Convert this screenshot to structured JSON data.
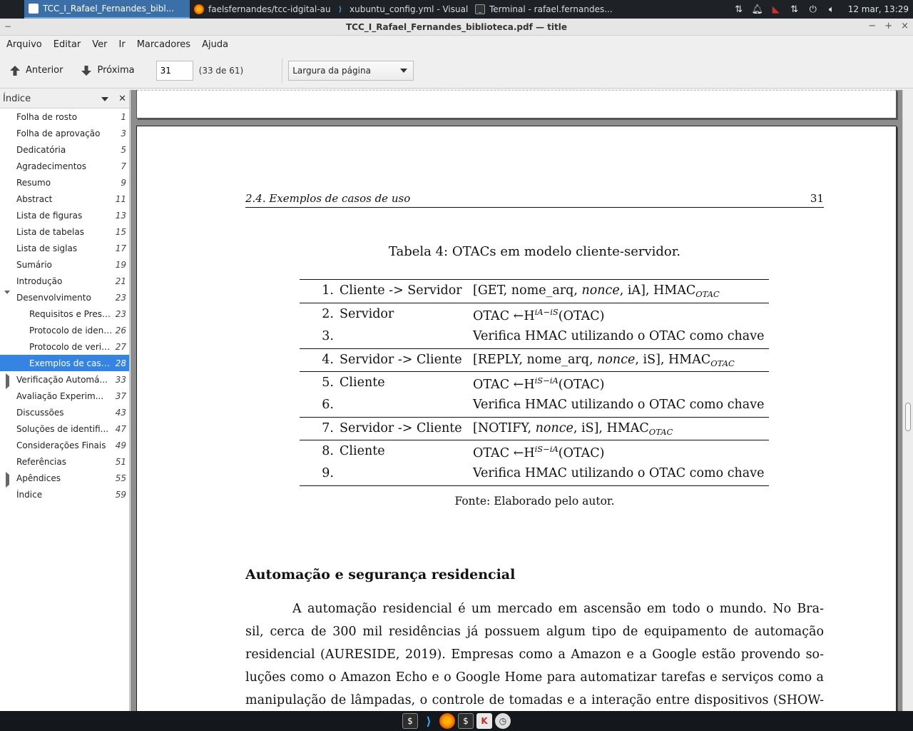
{
  "taskbar": {
    "tasks": [
      {
        "label": "TCC_I_Rafael_Fernandes_bibl...",
        "active": true
      },
      {
        "label": "faelsfernandes/tcc-idgital-au..."
      },
      {
        "label": "xubuntu_config.yml - Visual S..."
      },
      {
        "label": "Terminal - rafael.fernandes..."
      }
    ],
    "clock": "12 mar, 13:29",
    "tray_icons": [
      "network-icon",
      "notification-bell-icon",
      "antivirus-icon",
      "network-transfer-icon",
      "power-icon",
      "volume-icon"
    ]
  },
  "window": {
    "title": "TCC_I_Rafael_Fernandes_biblioteca.pdf — title",
    "menu_button": "−",
    "controls": [
      "−",
      "+",
      "×"
    ]
  },
  "menubar": [
    "Arquivo",
    "Editar",
    "Ver",
    "Ir",
    "Marcadores",
    "Ajuda"
  ],
  "toolbar": {
    "prev_label": "Anterior",
    "next_label": "Próxima",
    "page_value": "31",
    "page_count": "(33 de 61)",
    "zoom": "Largura da página"
  },
  "sidebar": {
    "title": "Índice",
    "items": [
      {
        "label": "Folha de rosto",
        "page": "1"
      },
      {
        "label": "Folha de aprovação",
        "page": "3"
      },
      {
        "label": "Dedicatória",
        "page": "5"
      },
      {
        "label": "Agradecimentos",
        "page": "7"
      },
      {
        "label": "Resumo",
        "page": "9"
      },
      {
        "label": "Abstract",
        "page": "11"
      },
      {
        "label": "Lista de figuras",
        "page": "13"
      },
      {
        "label": "Lista de tabelas",
        "page": "15"
      },
      {
        "label": "Lista de siglas",
        "page": "17"
      },
      {
        "label": "Sumário",
        "page": "19"
      },
      {
        "label": "Introdução",
        "page": "21"
      },
      {
        "label": "Desenvolvimento",
        "page": "23",
        "expanded": true
      },
      {
        "label": "Requisitos e Pressu...",
        "page": "23",
        "level": 2
      },
      {
        "label": "Protocolo de identif...",
        "page": "26",
        "level": 2
      },
      {
        "label": "Protocolo de verific...",
        "page": "27",
        "level": 2
      },
      {
        "label": "Exemplos de casos ...",
        "page": "28",
        "level": 2,
        "selected": true
      },
      {
        "label": "Verificação Automá...",
        "page": "33",
        "collapsed": true
      },
      {
        "label": "Avaliação Experim...",
        "page": "37"
      },
      {
        "label": "Discussões",
        "page": "43"
      },
      {
        "label": "Soluções de identifi...",
        "page": "47"
      },
      {
        "label": "Considerações Finais",
        "page": "49"
      },
      {
        "label": "Referências",
        "page": "51"
      },
      {
        "label": "Apêndices",
        "page": "55",
        "collapsed": true
      },
      {
        "label": "Índice",
        "page": "59"
      }
    ]
  },
  "document": {
    "running_head_section": "2.4.   Exemplos de casos de uso",
    "running_head_page": "31",
    "table_caption": "Tabela 4:  OTACs em modelo cliente-servidor.",
    "table_rows": [
      {
        "num": "1.",
        "actor": "Cliente -> Servidor",
        "a1": "[GET, nome_arq, ",
        "it": "nonce",
        "a2": ", iA], HMAC",
        "sub": "OTAC"
      },
      {
        "num": "2.",
        "actor": "Servidor",
        "a1": "OTAC ←H",
        "sup": "iA−iS",
        "a2": "(OTAC)"
      },
      {
        "num": "3.",
        "actor": "",
        "a1": "Verifica HMAC utilizando o OTAC como chave"
      },
      {
        "num": "4.",
        "actor": "Servidor -> Cliente",
        "a1": "[REPLY, nome_arq, ",
        "it": "nonce",
        "a2": ", iS], HMAC",
        "sub": "OTAC"
      },
      {
        "num": "5.",
        "actor": "Cliente",
        "a1": "OTAC ←H",
        "sup": "iS−iA",
        "a2": "(OTAC)"
      },
      {
        "num": "6.",
        "actor": "",
        "a1": "Verifica HMAC utilizando o OTAC como chave"
      },
      {
        "num": "7.",
        "actor": "Servidor -> Cliente",
        "a1": "[NOTIFY, ",
        "it": "nonce",
        "a2": ", iS], HMAC",
        "sub": "OTAC"
      },
      {
        "num": "8.",
        "actor": "Cliente",
        "a1": "OTAC ←H",
        "sup": "iS−iA",
        "a2": "(OTAC)"
      },
      {
        "num": "9.",
        "actor": "",
        "a1": "Verifica HMAC utilizando o OTAC como chave"
      }
    ],
    "source": "Fonte:  Elaborado pelo autor.",
    "section_title": "Automação e segurança residencial",
    "paragraph_lines": [
      "A automação residencial é um mercado em ascensão em todo o mundo.  No Bra-",
      "sil, cerca de 300 mil residências já possuem algum tipo de equipamento de automação",
      "residencial (AURESIDE, 2019).  Empresas como a Amazon e a Google estão provendo so-",
      "luções como o Amazon Echo e o Google Home para automatizar tarefas e serviços como a",
      "manipulação de lâmpadas, o controle de tomadas e a interação entre dispositivos (SHOW-"
    ]
  },
  "dock": [
    "terminal-icon",
    "vscode-icon",
    "firefox-icon",
    "terminal-icon",
    "kaspersky-icon",
    "clock-icon"
  ],
  "colors": {
    "selection": "#3584e4",
    "panel": "#1e2126",
    "active_task": "#3b6fa8"
  }
}
